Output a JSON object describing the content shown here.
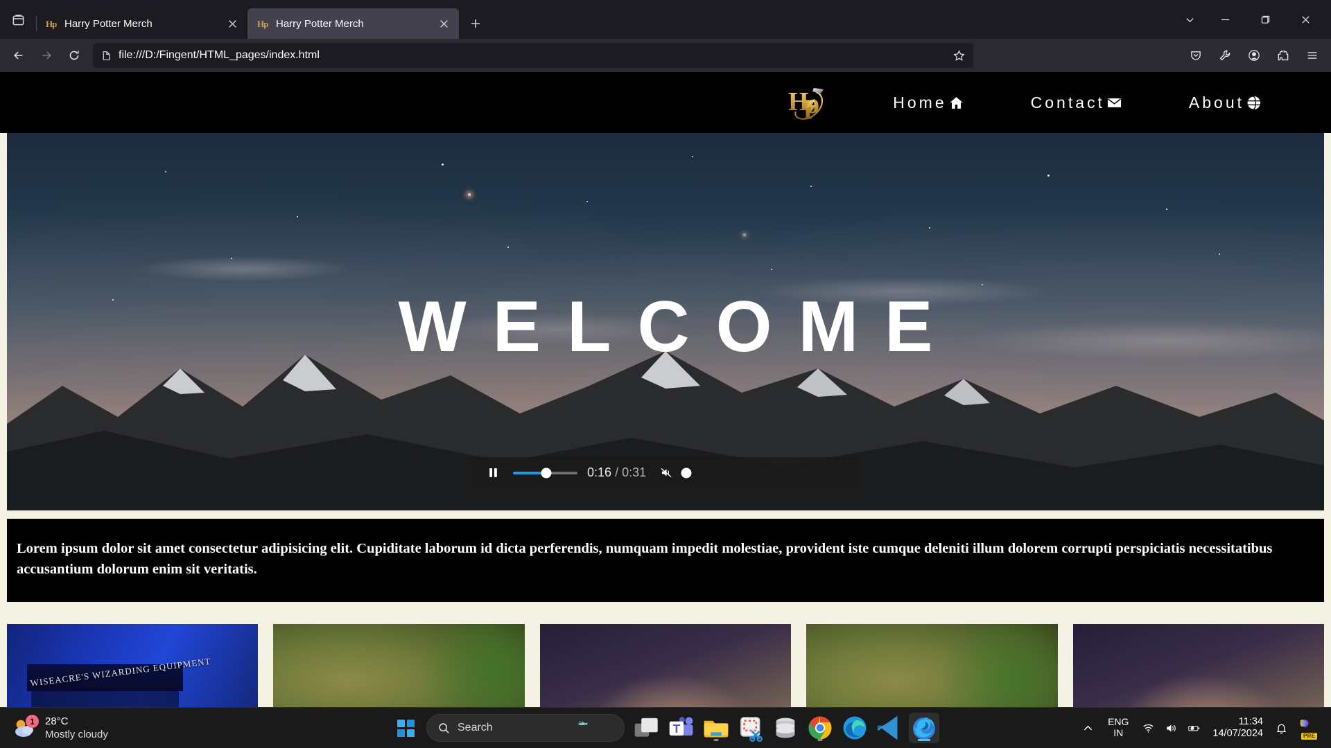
{
  "browser": {
    "tabs": [
      {
        "title": "Harry Potter Merch",
        "favicon": "hp-logo-favicon",
        "active": false
      },
      {
        "title": "Harry Potter Merch",
        "favicon": "hp-logo-favicon",
        "active": true
      }
    ],
    "tab_list_button": "list-all-tabs-icon",
    "new_tab_button": "plus-icon",
    "window_controls": {
      "chevron": "chevron-down-icon",
      "minimize": "minimize-icon",
      "maximize": "maximize-icon",
      "close": "close-icon"
    },
    "nav": {
      "back": "back-arrow-icon",
      "forward": "forward-arrow-icon",
      "reload": "reload-icon"
    },
    "urlbar": {
      "page_icon": "page-document-icon",
      "url": "file:///D:/Fingent/HTML_pages/index.html",
      "bookmark_icon": "star-icon"
    },
    "toolbar_right": [
      {
        "name": "pocket-save-icon",
        "label": "Save to Pocket"
      },
      {
        "name": "wrench-icon",
        "label": "Developer Tools"
      },
      {
        "name": "account-icon",
        "label": "Account"
      },
      {
        "name": "extensions-icon",
        "label": "Extensions"
      },
      {
        "name": "menu-hamburger-icon",
        "label": "Open application menu"
      }
    ]
  },
  "site": {
    "logo_alt": "HP Harry Potter logo",
    "nav_links": [
      {
        "label": "Home",
        "icon": "home-icon"
      },
      {
        "label": "Contact",
        "icon": "envelope-icon"
      },
      {
        "label": "About",
        "icon": "globe-icon"
      }
    ],
    "hero": {
      "title": "WELCOME",
      "video_controls": {
        "play_state_icon": "pause-icon",
        "current_time": "0:16",
        "separator": "/",
        "duration": "0:31",
        "progress_percent": 52,
        "mute_icon": "volume-muted-icon",
        "volume_percent": 0,
        "accent_color": "#1a9ce0"
      }
    },
    "lorem": "Lorem ipsum dolor sit amet consectetur adipisicing elit. Cupiditate laborum id dicta perferendis, numquam impedit molestiae, provident iste cumque deleniti illum dolorem corrupti perspiciatis necessitatibus accusantium dolorum enim sit veritatis.",
    "cards": [
      {
        "name": "card-wiseacres-shop",
        "caption": "WISEACRE'S WIZARDING EQUIPMENT"
      },
      {
        "name": "card-forest-green",
        "caption": ""
      },
      {
        "name": "card-hands-wand",
        "caption": ""
      },
      {
        "name": "card-forest-green-2",
        "caption": ""
      },
      {
        "name": "card-hands-wand-2",
        "caption": ""
      }
    ],
    "colors": {
      "page_bg": "#f4f2e2",
      "band_bg": "#000000",
      "logo_gold": "#d4a53a"
    }
  },
  "taskbar": {
    "weather": {
      "temperature": "28°C",
      "condition": "Mostly cloudy",
      "badge": "1",
      "icon": "sun-cloud-icon"
    },
    "start_button": "windows-start-icon",
    "search": {
      "placeholder": "Search",
      "icon": "search-icon",
      "decoration": "shark-image"
    },
    "apps": [
      {
        "name": "task-view-icon",
        "label": "Task View",
        "running": false,
        "active": false
      },
      {
        "name": "microsoft-teams-icon",
        "label": "Microsoft Teams",
        "running": false,
        "active": false
      },
      {
        "name": "file-explorer-icon",
        "label": "File Explorer",
        "running": true,
        "active": false
      },
      {
        "name": "snipping-tool-icon",
        "label": "Snipping Tool",
        "running": false,
        "active": false
      },
      {
        "name": "database-icon",
        "label": "SQL Database",
        "running": false,
        "active": false
      },
      {
        "name": "google-chrome-icon",
        "label": "Google Chrome",
        "running": true,
        "active": false
      },
      {
        "name": "microsoft-edge-icon",
        "label": "Microsoft Edge",
        "running": false,
        "active": false
      },
      {
        "name": "vs-code-icon",
        "label": "Visual Studio Code",
        "running": false,
        "active": false
      },
      {
        "name": "firefox-icon",
        "label": "Mozilla Firefox",
        "running": true,
        "active": true
      }
    ],
    "tray": {
      "show_hidden_icon": "chevron-up-icon",
      "language_line1": "ENG",
      "language_line2": "IN",
      "wifi_icon": "wifi-icon",
      "volume_icon": "speaker-icon",
      "battery_icon": "battery-charging-icon",
      "time": "11:34",
      "date": "14/07/2024",
      "notifications_icon": "bell-icon",
      "copilot": {
        "icon": "copilot-icon",
        "badge": "PRE"
      }
    }
  }
}
